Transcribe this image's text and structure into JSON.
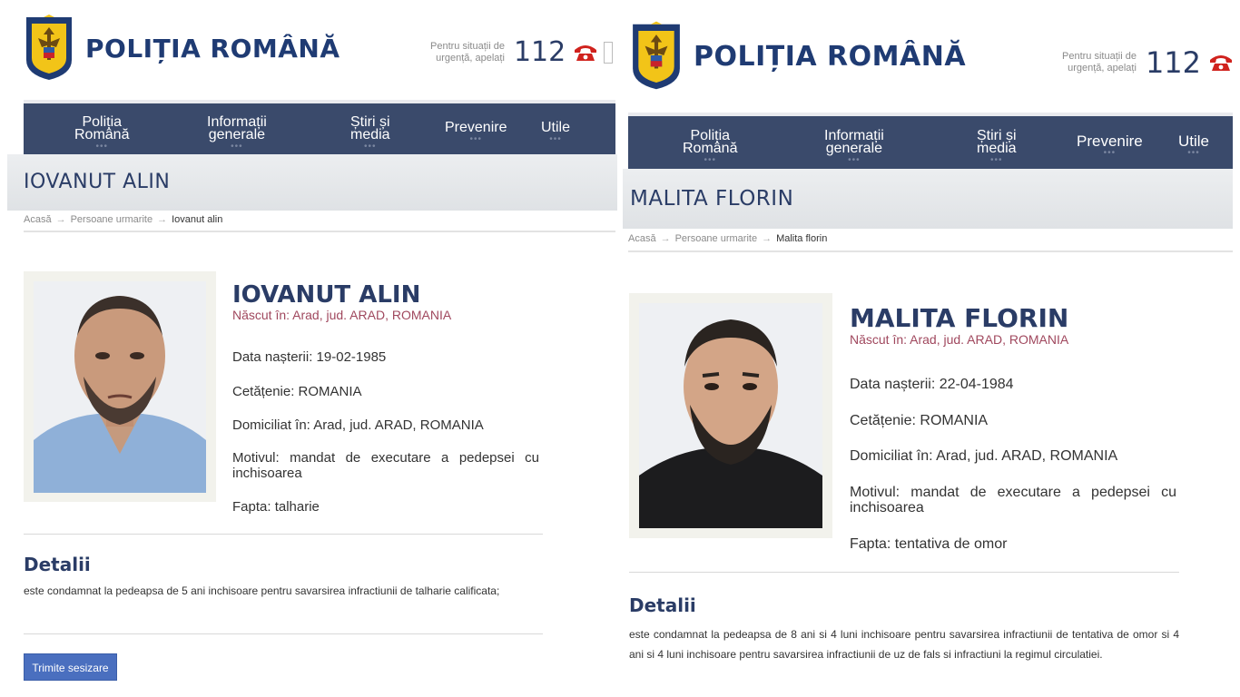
{
  "header": {
    "logo_text": "POLIȚIA ROMÂNĂ",
    "emergency_line1": "Pentru situații de",
    "emergency_line2": "urgență, apelați",
    "emergency_number": "112"
  },
  "nav": {
    "items": [
      {
        "line1": "Poliția",
        "line2": "Română"
      },
      {
        "line1": "Informații",
        "line2": "generale"
      },
      {
        "line1": "Știri și",
        "line2": "media"
      },
      {
        "line1": "Prevenire",
        "line2": ""
      },
      {
        "line1": "Utile",
        "line2": ""
      }
    ],
    "dots": "•••"
  },
  "colors": {
    "nav_bg": "#3a4a6b",
    "name": "#2a3c66",
    "born": "#a0485e",
    "button": "#4a6fbf",
    "phone_icon": "#d0221d"
  },
  "panels": [
    {
      "title": "IOVANUT ALIN",
      "breadcrumb": {
        "home": "Acasă",
        "section": "Persoane urmarite",
        "current": "Iovanut alin"
      },
      "person": {
        "name": "IOVANUT ALIN",
        "born": "Născut în: Arad, jud. ARAD, ROMANIA",
        "birth_date": "Data nașterii: 19-02-1985",
        "citizenship": "Cetățenie: ROMANIA",
        "domicile": "Domiciliat în: Arad, jud. ARAD, ROMANIA",
        "reason": "Motivul: mandat de executare a pedepsei cu inchisoarea",
        "deed": "Fapta: talharie"
      },
      "details_heading": "Detalii",
      "details_text": "este condamnat la pedeapsa de 5 ani inchisoare pentru savarsirea infractiunii de talharie calificata;",
      "button_label": "Trimite sesizare"
    },
    {
      "title": "MALITA FLORIN",
      "breadcrumb": {
        "home": "Acasă",
        "section": "Persoane urmarite",
        "current": "Malita florin"
      },
      "person": {
        "name": "MALITA FLORIN",
        "born": "Născut în: Arad, jud. ARAD, ROMANIA",
        "birth_date": "Data nașterii: 22-04-1984",
        "citizenship": "Cetățenie: ROMANIA",
        "domicile": "Domiciliat în: Arad, jud. ARAD, ROMANIA",
        "reason": "Motivul: mandat de executare a pedepsei cu inchisoarea",
        "deed": "Fapta: tentativa de omor"
      },
      "details_heading": "Detalii",
      "details_text": "este condamnat la pedeapsa de 8 ani si 4 luni inchisoare pentru savarsirea infractiunii de tentativa de omor si 4 ani si 4 luni inchisoare pentru savarsirea infractiunii de uz de fals si infractiuni la regimul circulatiei."
    }
  ]
}
